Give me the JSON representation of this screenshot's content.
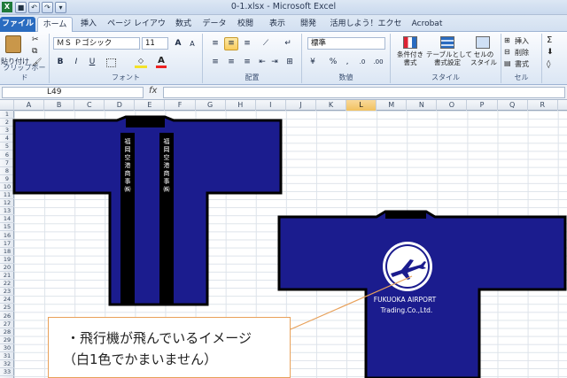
{
  "window": {
    "title": "0-1.xlsx - Microsoft Excel"
  },
  "tabs": [
    {
      "label": "ファイル"
    },
    {
      "label": "ホーム"
    },
    {
      "label": "挿入"
    },
    {
      "label": "ページ レイアウト"
    },
    {
      "label": "数式"
    },
    {
      "label": "データ"
    },
    {
      "label": "校閲"
    },
    {
      "label": "表示"
    },
    {
      "label": "開発"
    },
    {
      "label": "活用しよう！エクセル"
    },
    {
      "label": "Acrobat"
    }
  ],
  "ribbon": {
    "clipboard": {
      "paste": "貼り付け",
      "label": "クリップボード"
    },
    "font": {
      "name": "ＭＳ Ｐゴシック",
      "size": "11",
      "bold": "B",
      "italic": "I",
      "underline": "U",
      "label": "フォント",
      "grow": "A",
      "shrink": "A"
    },
    "alignment": {
      "label": "配置"
    },
    "number": {
      "format": "標準",
      "label": "数値"
    },
    "styles": {
      "conditional": "条件付き\n書式",
      "table": "テーブルとして\n書式設定",
      "cell": "セルの\nスタイル",
      "label": "スタイル"
    },
    "cells": {
      "insert": "挿入",
      "delete": "削除",
      "format": "書式",
      "label": "セル"
    }
  },
  "formula_bar": {
    "name_box": "L49",
    "fx": "fx",
    "value": ""
  },
  "columns": [
    "A",
    "B",
    "C",
    "D",
    "E",
    "F",
    "G",
    "H",
    "I",
    "J",
    "K",
    "L",
    "M",
    "N",
    "O",
    "P",
    "Q",
    "R"
  ],
  "active_column": "L",
  "rows": [
    "1",
    "2",
    "3",
    "4",
    "5",
    "6",
    "7",
    "8",
    "9",
    "10",
    "11",
    "12",
    "13",
    "14",
    "15",
    "16",
    "17",
    "18",
    "19",
    "20",
    "21",
    "22",
    "23",
    "24",
    "25",
    "26",
    "27",
    "28",
    "29",
    "30",
    "31",
    "32",
    "33"
  ],
  "artwork": {
    "front_collar_text_left": "福岡空港商事㈱",
    "front_collar_text_right": "福岡空港商事㈱",
    "back_line1": "FUKUOKA  AIRPORT",
    "back_line2": "Trading.Co.,Ltd."
  },
  "callout": {
    "line1": "・飛行機が飛んでいるイメージ",
    "line2": "（白1色でかまいません）"
  },
  "colors": {
    "coat": "#1b1c8e",
    "accent": "#2a6cc0",
    "callout_border": "#e8a15a"
  }
}
